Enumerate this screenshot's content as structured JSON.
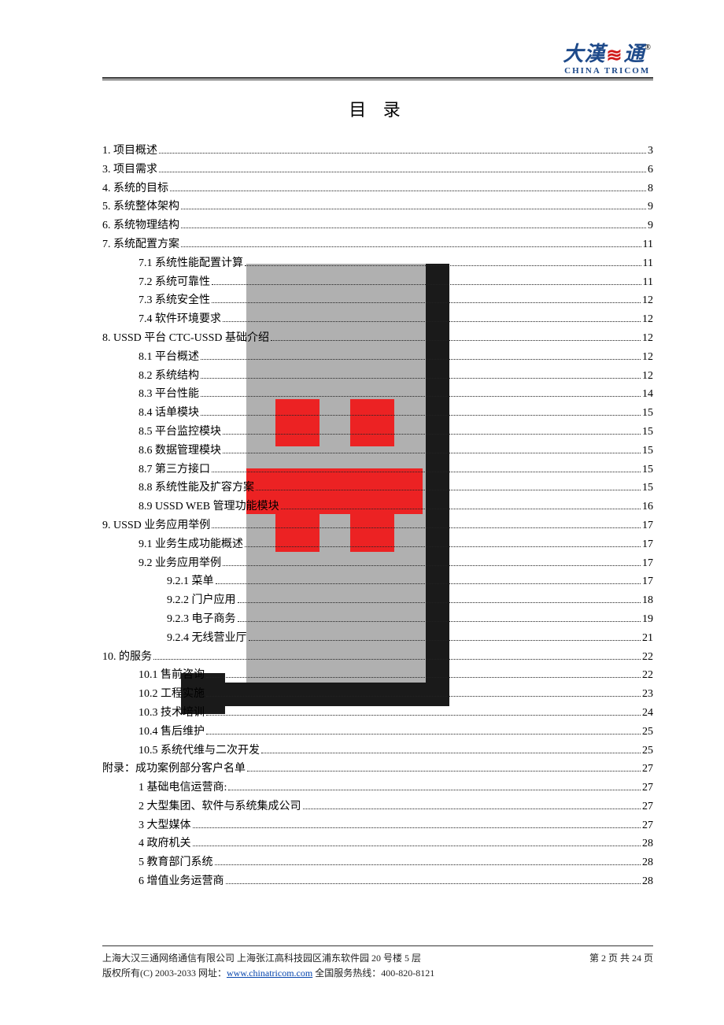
{
  "logo": {
    "main_left": "大漢",
    "main_right": "通",
    "sub": "CHINA TRICOM",
    "reg": "®"
  },
  "title": "目 录",
  "toc": [
    {
      "level": 1,
      "label": "1.  项目概述",
      "page": "3"
    },
    {
      "level": 1,
      "label": "3.  项目需求",
      "page": "6"
    },
    {
      "level": 1,
      "label": "4.  系统的目标",
      "page": "8"
    },
    {
      "level": 1,
      "label": "5.  系统整体架构",
      "page": "9"
    },
    {
      "level": 1,
      "label": "6.  系统物理结构",
      "page": "9"
    },
    {
      "level": 1,
      "label": "7.  系统配置方案",
      "page": "11"
    },
    {
      "level": 2,
      "label": "7.1  系统性能配置计算",
      "page": "11"
    },
    {
      "level": 2,
      "label": "7.2  系统可靠性",
      "page": "11"
    },
    {
      "level": 2,
      "label": "7.3  系统安全性",
      "page": "12"
    },
    {
      "level": 2,
      "label": "7.4  软件环境要求",
      "page": "12"
    },
    {
      "level": 1,
      "label": "8. USSD 平台 CTC-USSD 基础介绍",
      "page": "12"
    },
    {
      "level": 2,
      "label": "8.1  平台概述",
      "page": "12"
    },
    {
      "level": 2,
      "label": "8.2  系统结构",
      "page": "12"
    },
    {
      "level": 2,
      "label": "8.3  平台性能",
      "page": "14"
    },
    {
      "level": 2,
      "label": "8.4 话单模块",
      "page": "15"
    },
    {
      "level": 2,
      "label": "8.5  平台监控模块",
      "page": "15"
    },
    {
      "level": 2,
      "label": "8.6  数据管理模块",
      "page": "15"
    },
    {
      "level": 2,
      "label": "8.7  第三方接口",
      "page": "15"
    },
    {
      "level": 2,
      "label": "8.8  系统性能及扩容方案",
      "page": "15"
    },
    {
      "level": 2,
      "label": "8.9 USSD    WEB 管理功能模块",
      "page": "16"
    },
    {
      "level": 1,
      "label": "9. USSD 业务应用举例",
      "page": "17"
    },
    {
      "level": 2,
      "label": "9.1  业务生成功能概述",
      "page": "17"
    },
    {
      "level": 2,
      "label": "9.2  业务应用举例",
      "page": "17"
    },
    {
      "level": 3,
      "label": "9.2.1  菜单",
      "page": "17"
    },
    {
      "level": 3,
      "label": "9.2.2  门户应用",
      "page": "18"
    },
    {
      "level": 3,
      "label": "9.2.3  电子商务",
      "page": "19"
    },
    {
      "level": 3,
      "label": "9.2.4  无线营业厅",
      "page": "21"
    },
    {
      "level": 1,
      "label": "10.  的服务",
      "page": "22"
    },
    {
      "level": 2,
      "label": "10.1  售前咨询",
      "page": "22"
    },
    {
      "level": 2,
      "label": "10.2  工程实施",
      "page": "23"
    },
    {
      "level": 2,
      "label": "10.3  技术培训",
      "page": "24"
    },
    {
      "level": 2,
      "label": "10.4  售后维护",
      "page": "25"
    },
    {
      "level": 2,
      "label": "10.5  系统代维与二次开发",
      "page": "25"
    },
    {
      "level": 1,
      "label": "附录：成功案例部分客户名单",
      "page": "27"
    },
    {
      "level": 2,
      "label": "1 基础电信运营商:",
      "page": "27"
    },
    {
      "level": 2,
      "label": "2 大型集团、软件与系统集成公司",
      "page": "27"
    },
    {
      "level": 2,
      "label": "3  大型媒体",
      "page": "27"
    },
    {
      "level": 2,
      "label": "4  政府机关",
      "page": "28"
    },
    {
      "level": 2,
      "label": "5 教育部门系统",
      "page": "28"
    },
    {
      "level": 2,
      "label": "6  增值业务运营商",
      "page": "28"
    }
  ],
  "footer": {
    "line1_left": "上海大汉三通网络通信有限公司  上海张江高科技园区浦东软件园 20 号楼 5 层",
    "line1_right": "第   2   页  共  24  页",
    "line2_prefix": "版权所有(C) 2003-2033    网址：",
    "line2_link": "www.chinatricom.com",
    "line2_suffix": "  全国服务热线：400-820-8121"
  }
}
